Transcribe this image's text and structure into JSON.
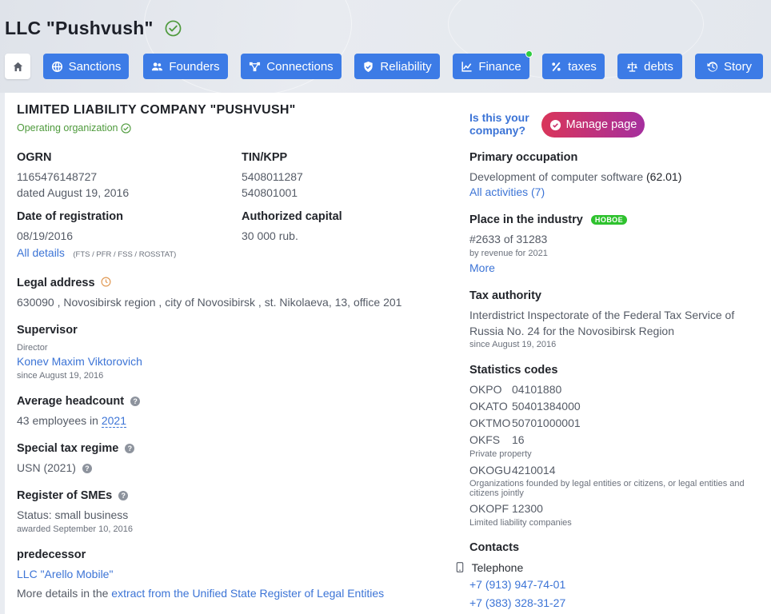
{
  "header": {
    "title": "LLC \"Pushvush\""
  },
  "tabs": [
    {
      "label": "Sanctions",
      "icon": "globe-icon"
    },
    {
      "label": "Founders",
      "icon": "people-icon"
    },
    {
      "label": "Connections",
      "icon": "network-icon"
    },
    {
      "label": "Reliability",
      "icon": "shield-check-icon"
    },
    {
      "label": "Finance",
      "icon": "chart-icon"
    },
    {
      "label": "taxes",
      "icon": "percent-icon"
    },
    {
      "label": "debts",
      "icon": "scales-icon"
    },
    {
      "label": "Story",
      "icon": "history-icon"
    }
  ],
  "company": {
    "full_name": "LIMITED LIABILITY COMPANY \"PUSHVUSH\"",
    "status": "Operating organization",
    "ogrn_label": "OGRN",
    "ogrn_value": "1165476148727",
    "ogrn_date": "dated August 19, 2016",
    "tin_label": "TIN/KPP",
    "tin_value": "5408011287",
    "kpp_value": "540801001",
    "reg_label": "Date of registration",
    "reg_value": "08/19/2016",
    "capital_label": "Authorized capital",
    "capital_value": "30 000 rub.",
    "all_details": "All details",
    "sources": "(FTS / PFR / FSS / ROSSTAT)",
    "address_label": "Legal address",
    "address_value": "630090 , Novosibirsk region , city of Novosibirsk , st. Nikolaeva, 13, office 201",
    "supervisor_label": "Supervisor",
    "supervisor_role": "Director",
    "supervisor_name": "Konev Maxim Viktorovich",
    "supervisor_since": "since August 19, 2016",
    "headcount_label": "Average headcount",
    "headcount_text": "43 employees in",
    "headcount_year": "2021",
    "tax_regime_label": "Special tax regime",
    "tax_regime_value": "USN (2021)",
    "sme_label": "Register of SMEs",
    "sme_status": "Status: small business",
    "sme_awarded": "awarded September 10, 2016",
    "predecessor_label": "predecessor",
    "predecessor_name": "LLC \"Arello Mobile\"",
    "more_details_text": "More details in the",
    "more_details_link": "extract from the Unified State Register of Legal Entities"
  },
  "right": {
    "is_your_company": "Is this your company?",
    "manage_page": "Manage page",
    "occupation_label": "Primary occupation",
    "occupation_value": "Development of computer software",
    "occupation_code": "(62.01)",
    "all_activities": "All activities (7)",
    "industry_label": "Place in the industry",
    "industry_badge": "НОВОЕ",
    "industry_rank": "#2633 of 31283",
    "industry_basis": "by revenue for 2021",
    "industry_more": "More",
    "tax_auth_label": "Tax authority",
    "tax_auth_value": "Interdistrict Inspectorate of the Federal Tax Service of Russia No. 24 for the Novosibirsk Region",
    "tax_auth_since": "since August 19, 2016",
    "stats_label": "Statistics codes",
    "okpo_k": "OKPO",
    "okpo_v": "04101880",
    "okato_k": "OKATO",
    "okato_v": "50401384000",
    "oktmo_k": "OKTMO",
    "oktmo_v": "50701000001",
    "okfs_k": "OKFS",
    "okfs_v": "16",
    "okfs_note": "Private property",
    "okogu_k": "OKOGU",
    "okogu_v": "4210014",
    "okogu_note": "Organizations founded by legal entities or citizens, or legal entities and citizens jointly",
    "okopf_k": "OKOPF",
    "okopf_v": "12300",
    "okopf_note": "Limited liability companies",
    "contacts_label": "Contacts",
    "telephone_label": "Telephone",
    "phone1": "+7 (913) 947-74-01",
    "phone2": "+7 (383) 328-31-27"
  },
  "colors": {
    "accent": "#3c7be6",
    "link": "#3c74d6",
    "ok": "#4e9a3c",
    "new_badge": "#2ec22e"
  }
}
